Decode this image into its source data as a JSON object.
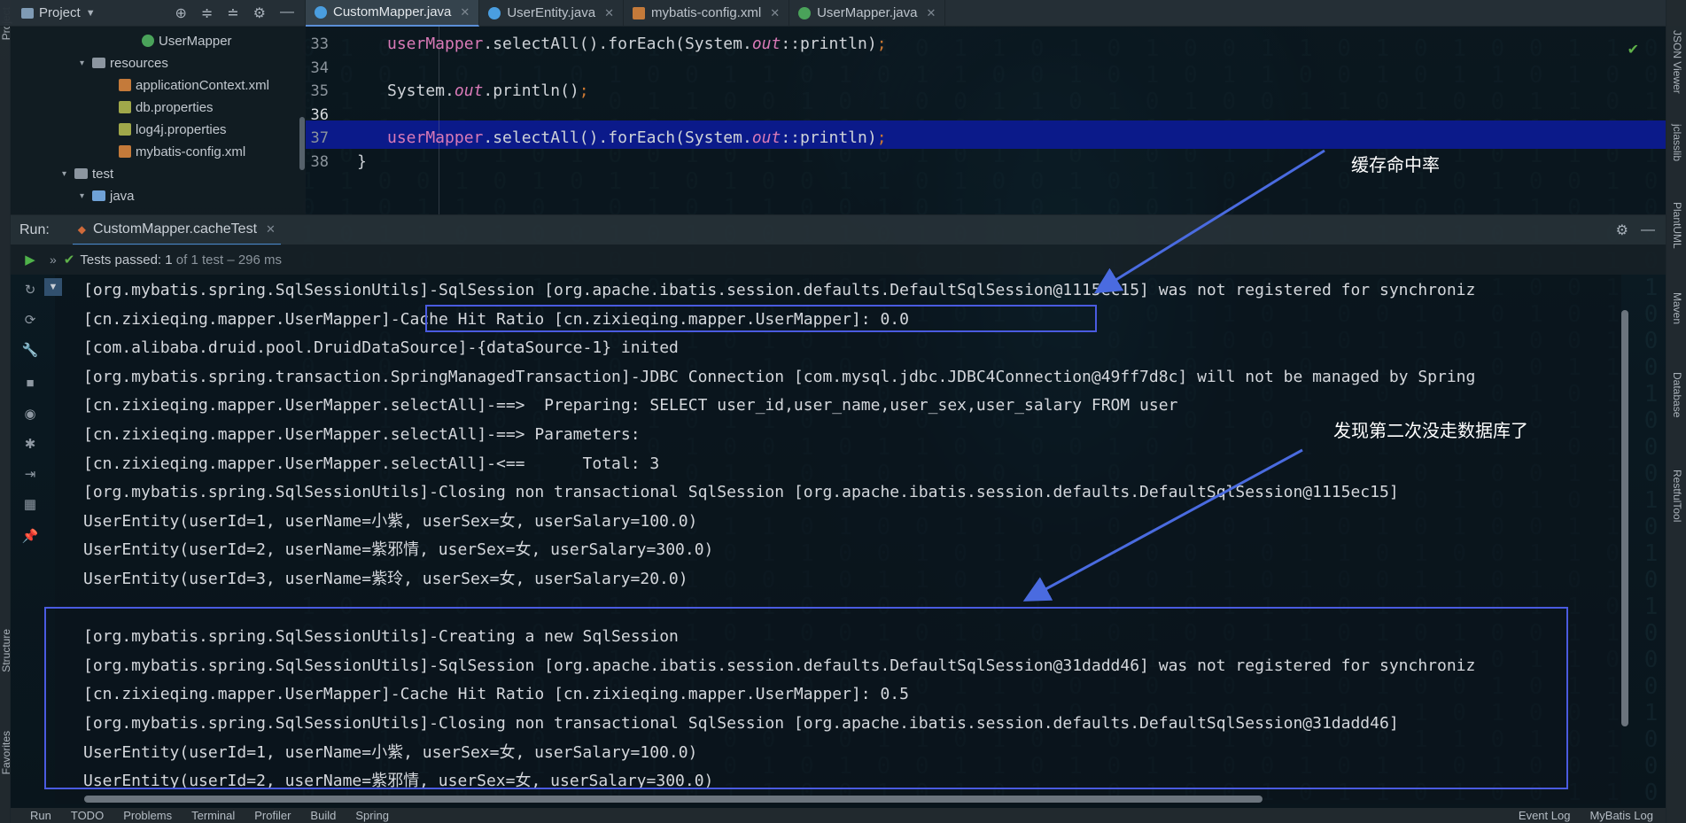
{
  "project_panel": {
    "title": "Project",
    "tree": [
      {
        "label": "UserMapper",
        "depth": 7,
        "icon": "interface",
        "arrow": ""
      },
      {
        "label": "resources",
        "depth": 4,
        "icon": "folder",
        "arrow": "▾"
      },
      {
        "label": "applicationContext.xml",
        "depth": 6,
        "icon": "xml",
        "arrow": ""
      },
      {
        "label": "db.properties",
        "depth": 6,
        "icon": "properties",
        "arrow": ""
      },
      {
        "label": "log4j.properties",
        "depth": 6,
        "icon": "properties",
        "arrow": ""
      },
      {
        "label": "mybatis-config.xml",
        "depth": 6,
        "icon": "xml",
        "arrow": ""
      },
      {
        "label": "test",
        "depth": 2,
        "icon": "folder",
        "arrow": "▾"
      },
      {
        "label": "java",
        "depth": 4,
        "icon": "folder-blue",
        "arrow": "▾"
      }
    ]
  },
  "editor_tabs": [
    {
      "label": "CustomMapper.java",
      "icon": "java",
      "active": true
    },
    {
      "label": "UserEntity.java",
      "icon": "java",
      "active": false
    },
    {
      "label": "mybatis-config.xml",
      "icon": "xml",
      "active": false
    },
    {
      "label": "UserMapper.java",
      "icon": "interface",
      "active": false
    }
  ],
  "editor": {
    "lines": [
      {
        "num": "33",
        "tokens": [
          [
            "var",
            "userMapper"
          ],
          [
            "p",
            ".selectAll().forEach(System."
          ],
          [
            "out",
            "out"
          ],
          [
            "p",
            "::println)"
          ],
          [
            "semi",
            ";"
          ]
        ]
      },
      {
        "num": "34",
        "tokens": []
      },
      {
        "num": "35",
        "tokens": [
          [
            "p",
            "System."
          ],
          [
            "out",
            "out"
          ],
          [
            "p",
            ".println()"
          ],
          [
            "semi",
            ";"
          ]
        ]
      },
      {
        "num": "36",
        "tokens": []
      },
      {
        "num": "37",
        "tokens": [
          [
            "var",
            "userMapper"
          ],
          [
            "p",
            ".selectAll().forEach(System."
          ],
          [
            "out",
            "out"
          ],
          [
            "p",
            "::println)"
          ],
          [
            "semi",
            ";"
          ]
        ]
      },
      {
        "num": "38",
        "tokens": [
          [
            "p",
            "}"
          ]
        ]
      }
    ],
    "highlighted_line": "36"
  },
  "run_panel": {
    "label": "Run:",
    "config_name": "CustomMapper.cacheTest",
    "status_prefix": "Tests passed:",
    "status_count": "1",
    "status_suffix": "of 1 test – 296 ms"
  },
  "console_lines": [
    "[org.mybatis.spring.SqlSessionUtils]-SqlSession [org.apache.ibatis.session.defaults.DefaultSqlSession@1115ec15] was not registered for synchroniz",
    "[cn.zixieqing.mapper.UserMapper]-Cache Hit Ratio [cn.zixieqing.mapper.UserMapper]: 0.0",
    "[com.alibaba.druid.pool.DruidDataSource]-{dataSource-1} inited",
    "[org.mybatis.spring.transaction.SpringManagedTransaction]-JDBC Connection [com.mysql.jdbc.JDBC4Connection@49ff7d8c] will not be managed by Spring",
    "[cn.zixieqing.mapper.UserMapper.selectAll]-==>  Preparing: SELECT user_id,user_name,user_sex,user_salary FROM user",
    "[cn.zixieqing.mapper.UserMapper.selectAll]-==> Parameters: ",
    "[cn.zixieqing.mapper.UserMapper.selectAll]-<==      Total: 3",
    "[org.mybatis.spring.SqlSessionUtils]-Closing non transactional SqlSession [org.apache.ibatis.session.defaults.DefaultSqlSession@1115ec15]",
    "UserEntity(userId=1, userName=小紫, userSex=女, userSalary=100.0)",
    "UserEntity(userId=2, userName=紫邪情, userSex=女, userSalary=300.0)",
    "UserEntity(userId=3, userName=紫玲, userSex=女, userSalary=20.0)",
    "",
    "[org.mybatis.spring.SqlSessionUtils]-Creating a new SqlSession",
    "[org.mybatis.spring.SqlSessionUtils]-SqlSession [org.apache.ibatis.session.defaults.DefaultSqlSession@31dadd46] was not registered for synchroniz",
    "[cn.zixieqing.mapper.UserMapper]-Cache Hit Ratio [cn.zixieqing.mapper.UserMapper]: 0.5",
    "[org.mybatis.spring.SqlSessionUtils]-Closing non transactional SqlSession [org.apache.ibatis.session.defaults.DefaultSqlSession@31dadd46]",
    "UserEntity(userId=1, userName=小紫, userSex=女, userSalary=100.0)",
    "UserEntity(userId=2, userName=紫邪情, userSex=女, userSalary=300.0)"
  ],
  "annotations": {
    "cache_hit_ratio": "缓存命中率",
    "no_db_second_time": "发现第二次没走数据库了"
  },
  "annotation_color": "#4a5be0",
  "left_strip": {
    "project": "Project",
    "structure": "Structure",
    "favorites": "Favorites"
  },
  "right_strip": [
    "JSON Viewer",
    "jclasslib",
    "PlantUML",
    "Maven",
    "Database",
    "RestfulTool"
  ],
  "bottom_bar": {
    "items": [
      "Run",
      "TODO",
      "Problems",
      "Terminal",
      "Profiler",
      "Build",
      "Spring"
    ],
    "right": [
      "Event Log",
      "MyBatis Log"
    ]
  }
}
